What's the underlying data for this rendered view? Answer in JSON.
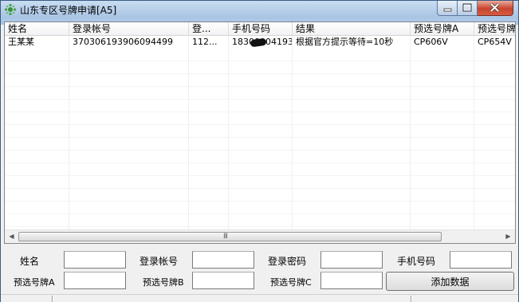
{
  "window": {
    "title": "山东专区号牌申请[A5]",
    "icon": "gear-cluster-icon"
  },
  "listview": {
    "columns": [
      "姓名",
      "登录帐号",
      "登...",
      "手机号码",
      "结果",
      "预选号牌A",
      "预选号牌"
    ],
    "rows": [
      [
        "王某某",
        "370306193906094499",
        "112...",
        "18300004193",
        "根据官方提示等待=10秒",
        "CP606V",
        "CP654V"
      ]
    ],
    "scroll_left": "◀",
    "scroll_right": "▶",
    "scroll_grip": "III"
  },
  "form": {
    "name_label": "姓名",
    "account_label": "登录帐号",
    "password_label": "登录密码",
    "phone_label": "手机号码",
    "plate_a_label": "预选号牌A",
    "plate_b_label": "预选号牌B",
    "plate_c_label": "预选号牌C",
    "add_button": "添加数据"
  }
}
